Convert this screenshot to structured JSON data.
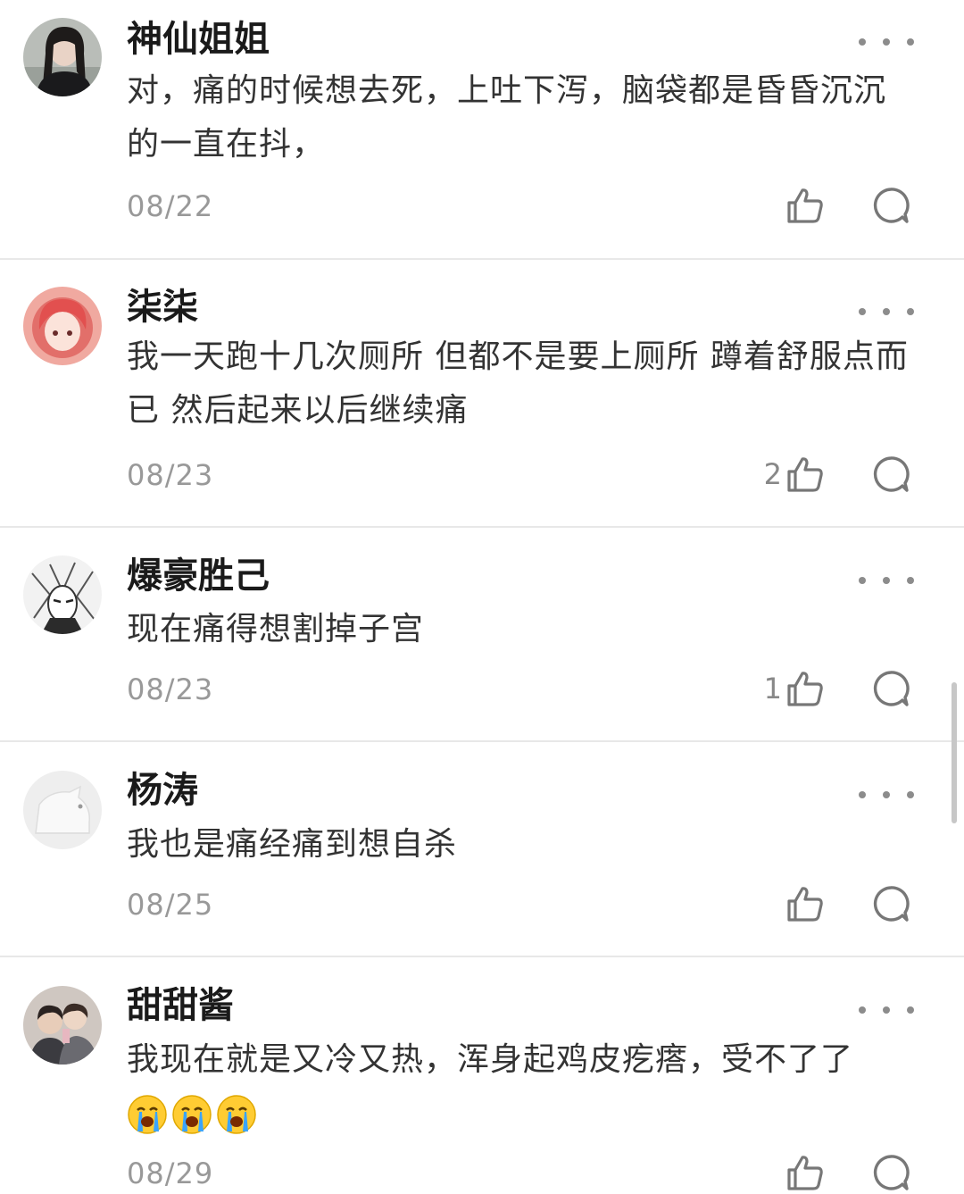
{
  "comments": [
    {
      "name": "神仙姐姐",
      "avatar": "avatar-girl-dark-hair",
      "text": "对，痛的时候想去死，上吐下泻，脑袋都是昏昏沉沉的一直在抖，",
      "date": "08/22",
      "likes": ""
    },
    {
      "name": "柒柒",
      "avatar": "avatar-anime-pink-hair",
      "text": "我一天跑十几次厕所  但都不是要上厕所  蹲着舒服点而已 然后起来以后继续痛",
      "date": "08/23",
      "likes": "2"
    },
    {
      "name": "爆豪胜己",
      "avatar": "avatar-manga-sketch",
      "text": "现在痛得想割掉子宫",
      "date": "08/23",
      "likes": "1"
    },
    {
      "name": "杨涛",
      "avatar": "avatar-default-grey",
      "text": "我也是痛经痛到想自杀",
      "date": "08/25",
      "likes": ""
    },
    {
      "name": "甜甜酱",
      "avatar": "avatar-couple-photo",
      "text": "我现在就是又冷又热，浑身起鸡皮疙瘩，受不了了",
      "emojis": [
        "crying-face-emoji",
        "crying-face-emoji",
        "crying-face-emoji"
      ],
      "date": "08/29",
      "likes": ""
    }
  ],
  "icons": {
    "more": "more-dots-icon",
    "like": "thumbs-up-icon",
    "reply": "comment-bubble-icon"
  }
}
